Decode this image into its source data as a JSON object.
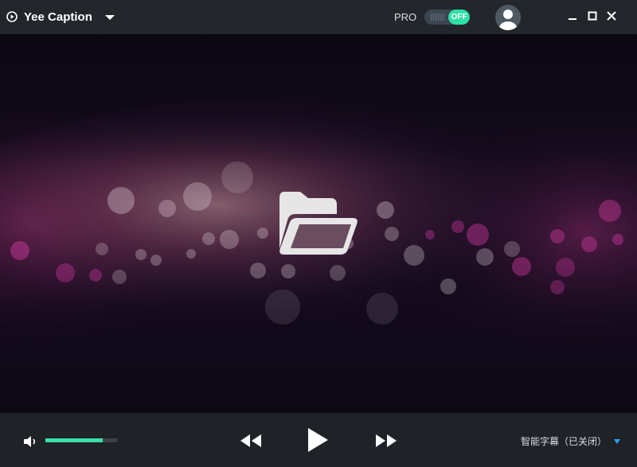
{
  "app": {
    "title": "Yee Caption"
  },
  "header": {
    "pro_label": "PRO",
    "pro_toggle_state": "OFF"
  },
  "icons": {
    "logo": "play-circle-icon",
    "dropdown": "chevron-down-icon",
    "avatar": "user-avatar-icon",
    "minimize": "minimize-icon",
    "maximize": "maximize-icon",
    "close": "close-icon",
    "open_file": "folder-open-icon",
    "volume": "speaker-icon",
    "rewind": "rewind-icon",
    "play": "play-icon",
    "forward": "fast-forward-icon"
  },
  "playback": {
    "volume_level": 0.8,
    "subtitle_label": "智能字幕（已关闭）"
  },
  "colors": {
    "accent": "#37e1a6",
    "titlebar": "#23272c",
    "controlbar": "#1f2328"
  }
}
